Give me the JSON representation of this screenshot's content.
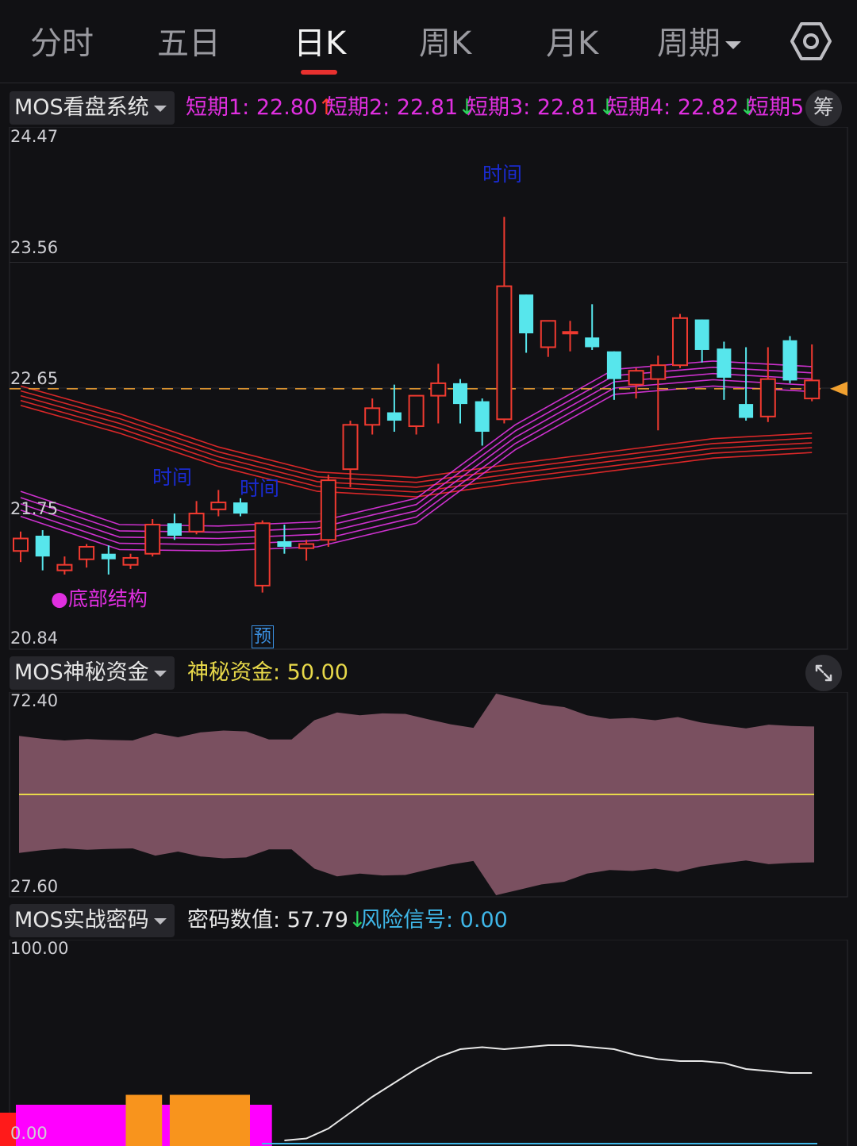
{
  "tabs": [
    {
      "label": "分时"
    },
    {
      "label": "五日"
    },
    {
      "label": "日K"
    },
    {
      "label": "周K"
    },
    {
      "label": "月K"
    },
    {
      "label": "周期"
    }
  ],
  "active_tab": "日K",
  "main_panel": {
    "indicator_name": "MOS看盘系统",
    "readouts": [
      {
        "text": "短期1: 22.80",
        "arrow": "↑",
        "color": "#e02fe0",
        "arrow_color": "#ff3b30"
      },
      {
        "text": "短期2: 22.81",
        "arrow": "↓",
        "color": "#e02fe0",
        "arrow_color": "#2bd45a"
      },
      {
        "text": "短期3: 22.81",
        "arrow": "↓",
        "color": "#e02fe0",
        "arrow_color": "#2bd45a"
      },
      {
        "text": "短期4: 22.82",
        "arrow": "↓",
        "color": "#e02fe0",
        "arrow_color": "#2bd45a"
      },
      {
        "text": "短期5",
        "arrow": "",
        "color": "#e02fe0",
        "arrow_color": ""
      }
    ],
    "chip_button": "筹",
    "y_labels": [
      "24.47",
      "23.56",
      "22.65",
      "21.75",
      "20.84"
    ],
    "annotations": {
      "time1": "时间",
      "time2": "时间",
      "time3": "时间",
      "bottom_structure": "●底部结构",
      "pre_marker": "预"
    }
  },
  "fund_panel": {
    "indicator_name": "MOS神秘资金",
    "readout": "神秘资金: 50.00",
    "readout_color": "#e8d94a",
    "y_labels": [
      "72.40",
      "27.60"
    ]
  },
  "code_panel": {
    "indicator_name": "MOS实战密码",
    "readout1": "密码数值: 57.79",
    "readout1_arrow": "↓",
    "readout2": "风险信号: 0.00",
    "readout2_color": "#3fb7e8",
    "y_labels": [
      "100.00",
      "0.00"
    ]
  },
  "colors": {
    "up": "#f03a30",
    "down": "#57e6ec",
    "accent": "#e8312f",
    "price_line": "#f0a030"
  },
  "chart_data": [
    {
      "type": "candlestick",
      "title": "",
      "ylim": [
        20.84,
        24.47
      ],
      "reference_price": 22.65,
      "candles": [
        {
          "o": 21.48,
          "c": 21.57,
          "h": 21.62,
          "l": 21.4
        },
        {
          "o": 21.59,
          "c": 21.44,
          "h": 21.63,
          "l": 21.34
        },
        {
          "o": 21.34,
          "c": 21.38,
          "h": 21.44,
          "l": 21.31
        },
        {
          "o": 21.42,
          "c": 21.51,
          "h": 21.53,
          "l": 21.36
        },
        {
          "o": 21.46,
          "c": 21.42,
          "h": 21.52,
          "l": 21.31
        },
        {
          "o": 21.38,
          "c": 21.43,
          "h": 21.46,
          "l": 21.35
        },
        {
          "o": 21.46,
          "c": 21.67,
          "h": 21.71,
          "l": 21.44
        },
        {
          "o": 21.68,
          "c": 21.59,
          "h": 21.75,
          "l": 21.56
        },
        {
          "o": 21.62,
          "c": 21.75,
          "h": 21.84,
          "l": 21.6
        },
        {
          "o": 21.78,
          "c": 21.83,
          "h": 21.92,
          "l": 21.73
        },
        {
          "o": 21.83,
          "c": 21.75,
          "h": 21.86,
          "l": 21.73
        },
        {
          "o": 21.23,
          "c": 21.68,
          "h": 21.7,
          "l": 21.18
        },
        {
          "o": 21.55,
          "c": 21.51,
          "h": 21.67,
          "l": 21.46
        },
        {
          "o": 21.5,
          "c": 21.53,
          "h": 21.56,
          "l": 21.41
        },
        {
          "o": 21.56,
          "c": 21.99,
          "h": 22.03,
          "l": 21.51
        },
        {
          "o": 22.07,
          "c": 22.39,
          "h": 22.42,
          "l": 21.94
        },
        {
          "o": 22.39,
          "c": 22.51,
          "h": 22.58,
          "l": 22.32
        },
        {
          "o": 22.48,
          "c": 22.42,
          "h": 22.68,
          "l": 22.34
        },
        {
          "o": 22.38,
          "c": 22.6,
          "h": 22.6,
          "l": 22.32
        },
        {
          "o": 22.6,
          "c": 22.69,
          "h": 22.83,
          "l": 22.4
        },
        {
          "o": 22.69,
          "c": 22.54,
          "h": 22.72,
          "l": 22.4
        },
        {
          "o": 22.56,
          "c": 22.34,
          "h": 22.58,
          "l": 22.24
        },
        {
          "o": 22.43,
          "c": 23.39,
          "h": 23.89,
          "l": 22.4
        },
        {
          "o": 23.33,
          "c": 23.05,
          "h": 23.33,
          "l": 22.91
        },
        {
          "o": 22.95,
          "c": 23.14,
          "h": 23.14,
          "l": 22.88
        },
        {
          "o": 23.05,
          "c": 23.06,
          "h": 23.14,
          "l": 22.92
        },
        {
          "o": 23.02,
          "c": 22.95,
          "h": 23.26,
          "l": 22.93
        },
        {
          "o": 22.92,
          "c": 22.72,
          "h": 22.92,
          "l": 22.57
        },
        {
          "o": 22.68,
          "c": 22.78,
          "h": 22.8,
          "l": 22.58
        },
        {
          "o": 22.72,
          "c": 22.82,
          "h": 22.89,
          "l": 22.35
        },
        {
          "o": 22.82,
          "c": 23.16,
          "h": 23.19,
          "l": 22.8
        },
        {
          "o": 23.15,
          "c": 22.93,
          "h": 23.15,
          "l": 22.84
        },
        {
          "o": 22.94,
          "c": 22.73,
          "h": 22.99,
          "l": 22.57
        },
        {
          "o": 22.54,
          "c": 22.44,
          "h": 22.95,
          "l": 22.42
        },
        {
          "o": 22.45,
          "c": 22.72,
          "h": 22.95,
          "l": 22.41
        },
        {
          "o": 23.0,
          "c": 22.71,
          "h": 23.03,
          "l": 22.69
        },
        {
          "o": 22.58,
          "c": 22.71,
          "h": 22.97,
          "l": 22.56
        }
      ],
      "ribbons": [
        {
          "name": "",
          "color": "#ee2a2a",
          "values": [
            22.6,
            22.4,
            22.16,
            21.98,
            21.94,
            22.04,
            22.13,
            22.22,
            22.26
          ]
        },
        {
          "name": "",
          "color": "#e235e2",
          "values": [
            21.82,
            21.58,
            21.57,
            21.6,
            21.77,
            22.3,
            22.7,
            22.76,
            22.72
          ]
        }
      ]
    },
    {
      "type": "area",
      "title": "",
      "ylim": [
        27.6,
        72.4
      ],
      "baseline": 50.0,
      "values": [
        63.0,
        62.4,
        62.0,
        62.3,
        62.1,
        62.0,
        63.6,
        62.7,
        63.8,
        64.2,
        64.0,
        62.2,
        62.2,
        66.5,
        68.2,
        67.6,
        68.0,
        67.9,
        66.7,
        65.6,
        64.8,
        72.4,
        71.2,
        70.0,
        69.4,
        67.6,
        66.8,
        67.0,
        66.5,
        67.2,
        66.0,
        65.3,
        64.7,
        65.5,
        65.2,
        65.1
      ],
      "fill_color": "#7a5060",
      "line_color": "#e8d94a"
    },
    {
      "type": "line",
      "title": "",
      "ylim": [
        0,
        100
      ],
      "values": [
        null,
        null,
        null,
        null,
        null,
        null,
        null,
        null,
        null,
        null,
        null,
        null,
        2,
        3,
        8,
        16,
        24,
        31,
        38,
        44,
        48,
        49,
        48,
        49,
        50,
        50,
        49,
        48,
        45,
        43,
        42,
        42,
        41,
        38,
        37,
        36,
        36
      ],
      "line_color": "#e8e8e8",
      "bars": [
        {
          "from": 0,
          "to": 11,
          "value": 20,
          "color": "#ff00ff"
        },
        {
          "from": 5,
          "to": 6,
          "value": 25,
          "color": "#f8941d"
        },
        {
          "from": 7,
          "to": 10,
          "value": 25,
          "color": "#f8941d"
        }
      ]
    }
  ]
}
